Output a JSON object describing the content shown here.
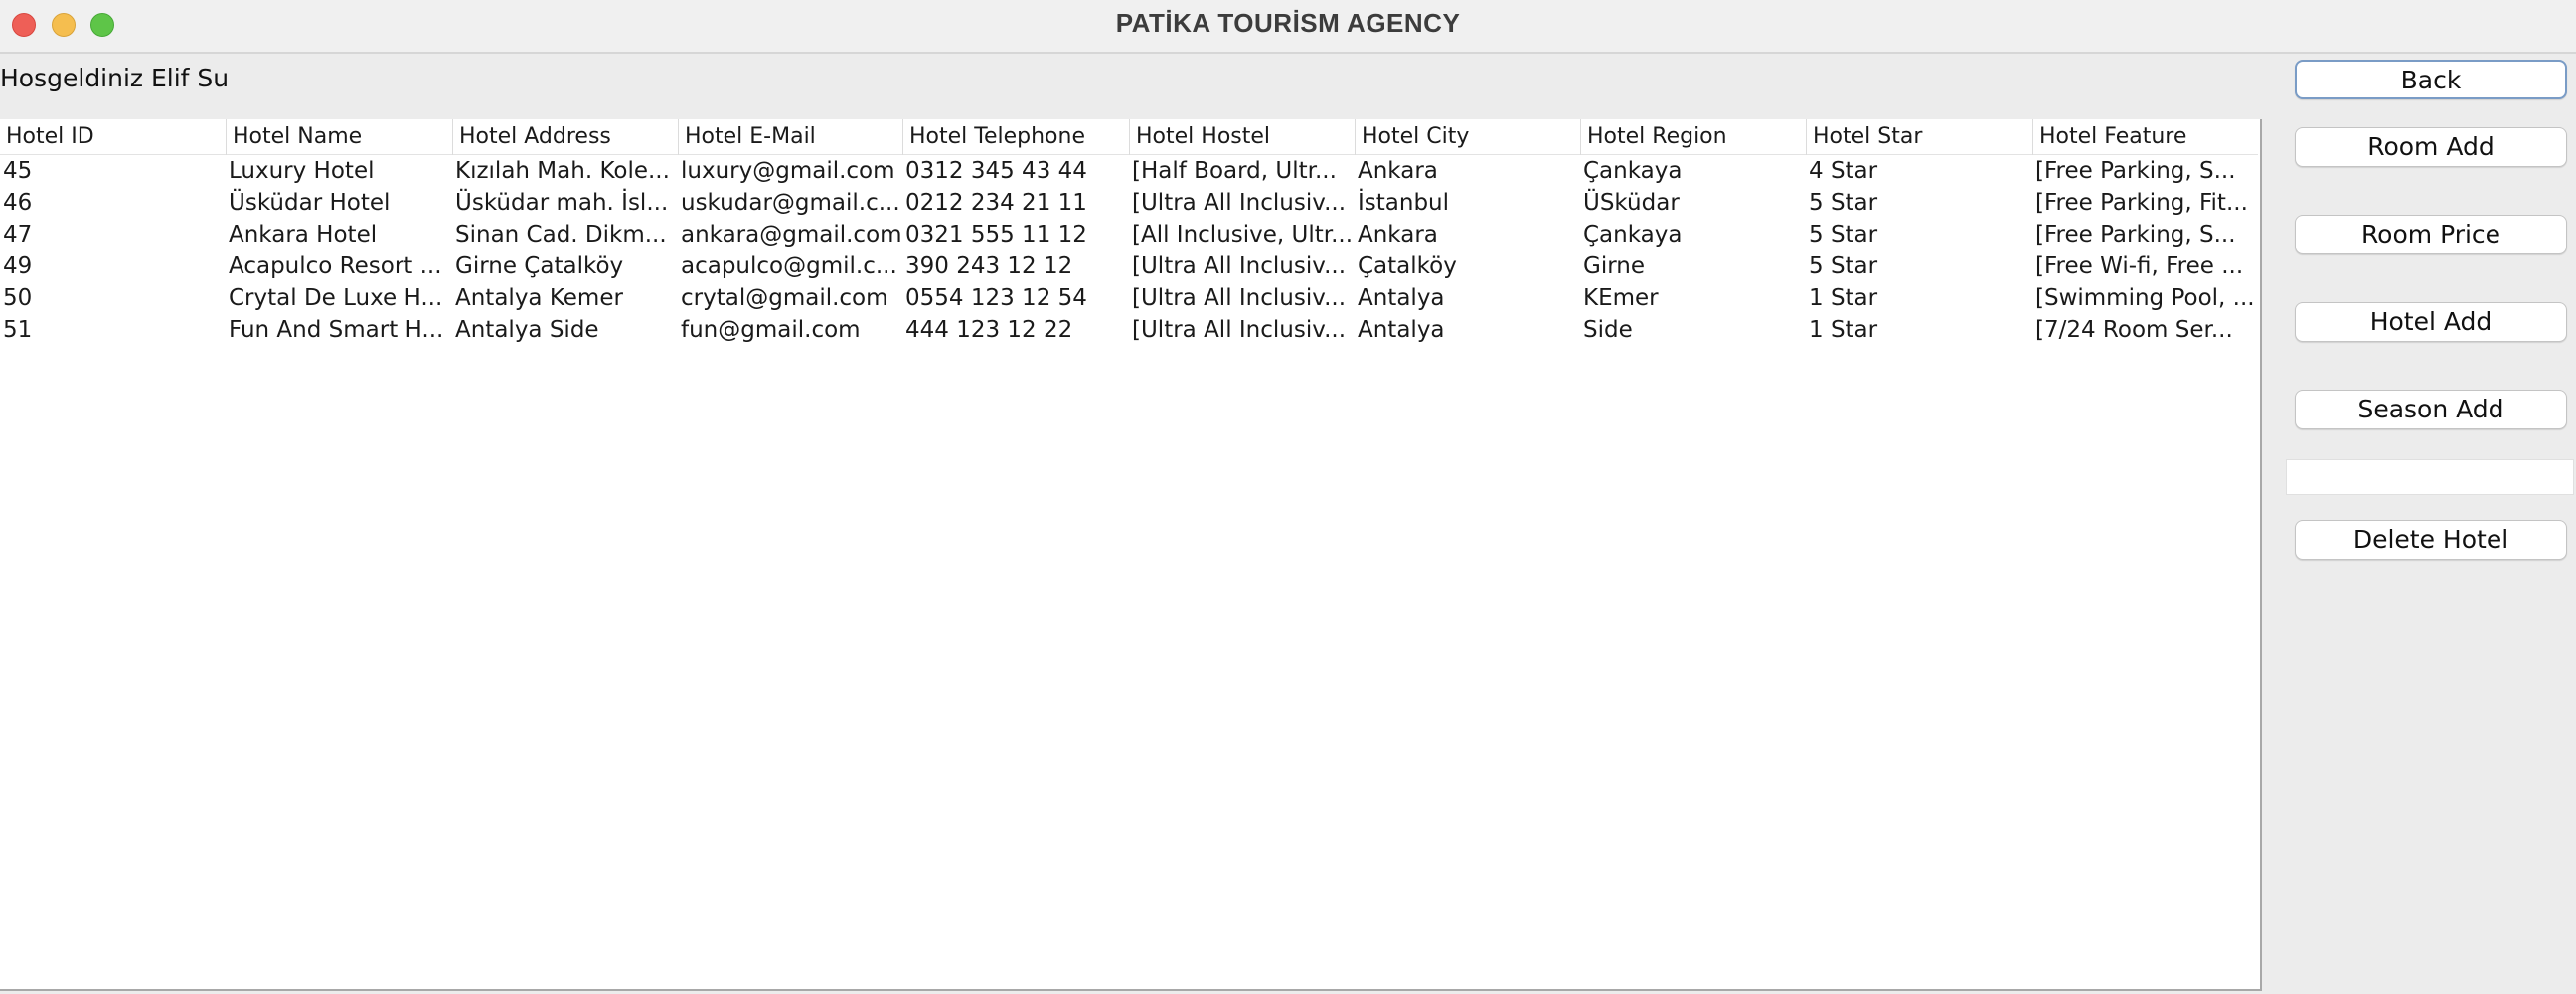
{
  "window": {
    "title": "PATİKA TOURİSM AGENCY"
  },
  "welcome_text": "Hosgeldiniz Elif Su",
  "table": {
    "columns": [
      "Hotel ID",
      "Hotel Name",
      "Hotel Address",
      "Hotel E-Mail",
      "Hotel Telephone",
      "Hotel Hostel",
      "Hotel City",
      "Hotel Region",
      "Hotel Star",
      "Hotel Feature"
    ],
    "rows": [
      [
        "45",
        "Luxury Hotel",
        "Kızılah Mah. Kole...",
        "luxury@gmail.com",
        "0312 345 43 44",
        "[Half Board, Ultr...",
        "Ankara",
        "Çankaya",
        "4 Star",
        "[Free Parking, S..."
      ],
      [
        "46",
        "Üsküdar Hotel",
        "Üsküdar mah. İsl...",
        "uskudar@gmail.c...",
        "0212 234 21 11",
        "[Ultra All Inclusiv...",
        "İstanbul",
        "ÜSküdar",
        "5 Star",
        "[Free Parking, Fit..."
      ],
      [
        "47",
        "Ankara Hotel",
        "Sinan Cad. Dikm...",
        "ankara@gmail.com",
        "0321 555 11 12",
        "[All Inclusive, Ultr...",
        "Ankara",
        "Çankaya",
        "5 Star",
        "[Free Parking, S..."
      ],
      [
        "49",
        "Acapulco Resort ...",
        "Girne Çatalköy",
        "acapulco@gmil.c...",
        "390 243 12 12",
        "[Ultra All Inclusiv...",
        "Çatalköy",
        "Girne",
        "5 Star",
        "[Free Wi-fi, Free ..."
      ],
      [
        "50",
        "Crytal De Luxe H...",
        "Antalya Kemer",
        "crytal@gmail.com",
        "0554 123  12 54",
        "[Ultra All Inclusiv...",
        "Antalya",
        "KEmer",
        "1 Star",
        "[Swimming Pool, ..."
      ],
      [
        "51",
        "Fun And Smart H...",
        "Antalya Side",
        "fun@gmail.com",
        "444 123 12 22",
        "[Ultra All Inclusiv...",
        "Antalya",
        "Side",
        "1 Star",
        "[7/24 Room Ser..."
      ]
    ]
  },
  "buttons": {
    "back": "Back",
    "room_add": "Room Add",
    "room_price": "Room Price",
    "hotel_add": "Hotel Add",
    "season_add": "Season Add",
    "delete_hotel": "Delete Hotel"
  },
  "delete_hotel_field": {
    "value": ""
  }
}
